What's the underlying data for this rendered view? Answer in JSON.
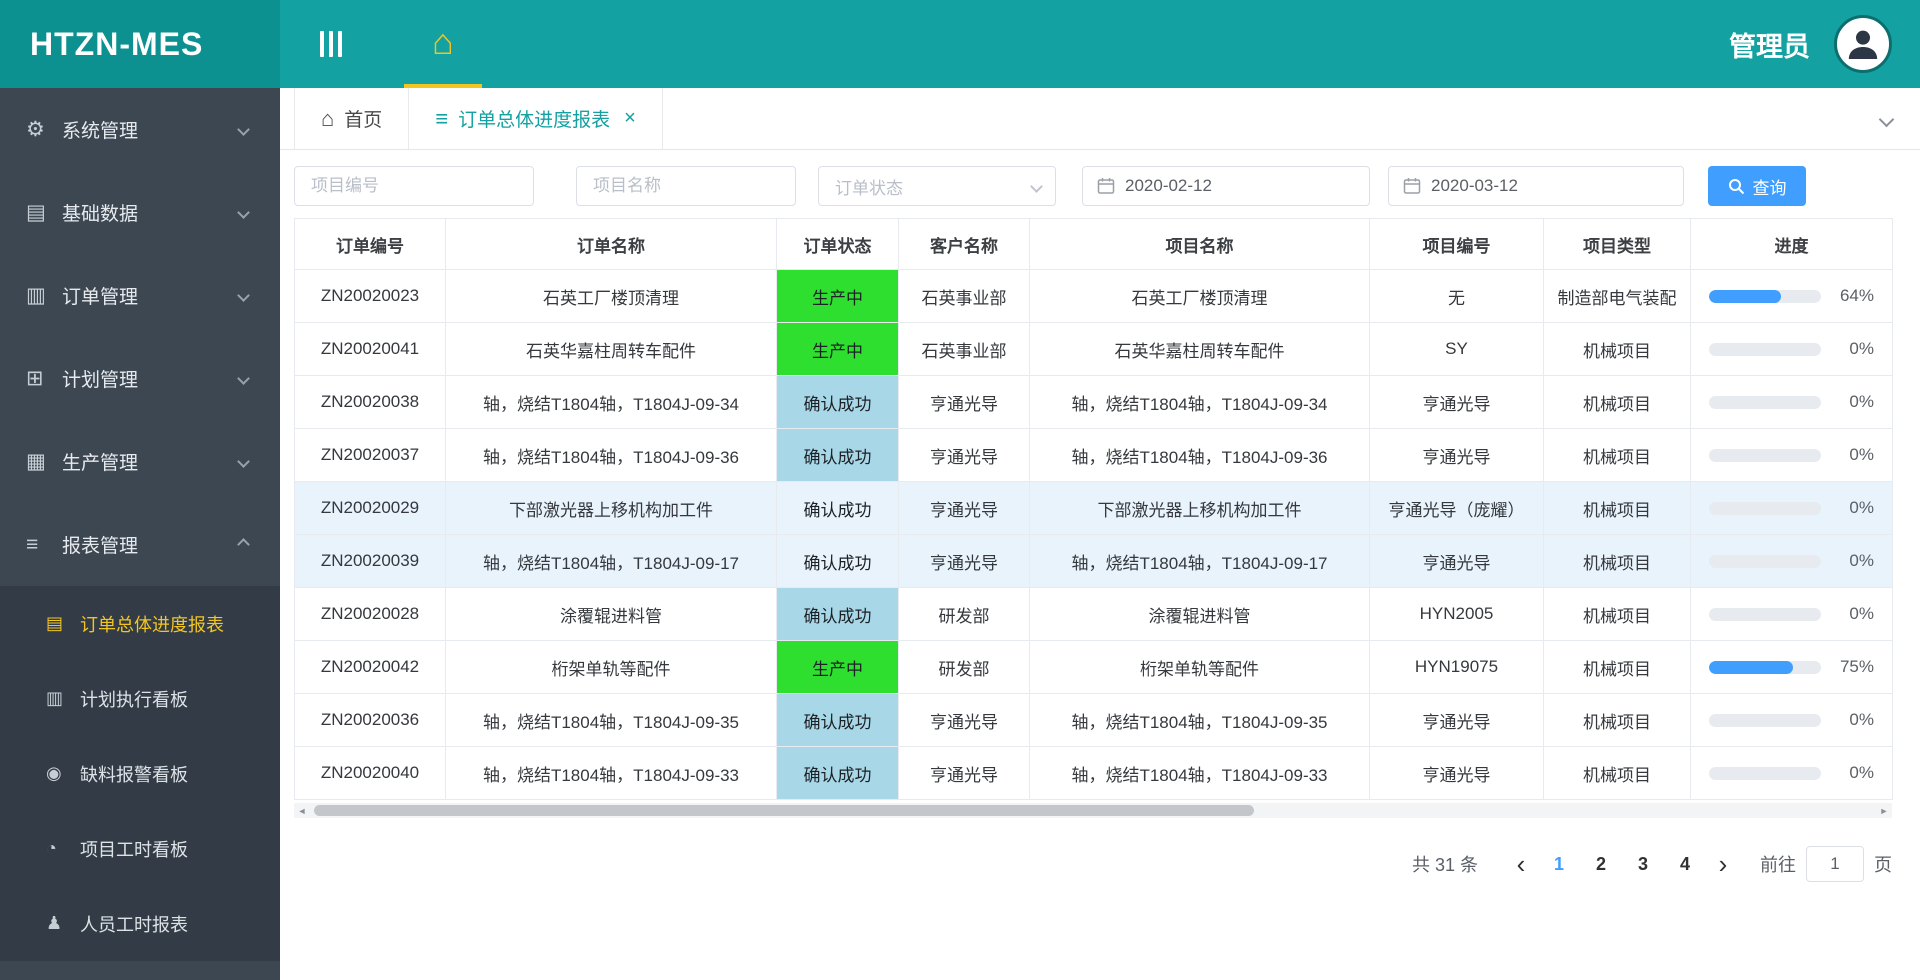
{
  "app": {
    "logo": "HTZN-MES",
    "user": "管理员"
  },
  "colors": {
    "header_teal": "#13a1a1",
    "logo_teal": "#0c9090",
    "sidebar_dark": "#3d4751",
    "active_gold": "#f2c521",
    "primary_blue": "#409eff",
    "status_green": "#2fdf2f",
    "status_light_blue": "#a8d8e8",
    "highlight_row": "#e8f3fc"
  },
  "sidebar": {
    "items": [
      {
        "label": "系统管理",
        "glyph": "⚙"
      },
      {
        "label": "基础数据",
        "glyph": "▤"
      },
      {
        "label": "订单管理",
        "glyph": "▥"
      },
      {
        "label": "计划管理",
        "glyph": "⊞"
      },
      {
        "label": "生产管理",
        "glyph": "▦"
      },
      {
        "label": "报表管理",
        "glyph": "≡"
      }
    ],
    "report_subitems": [
      {
        "label": "订单总体进度报表",
        "glyph": "▤",
        "active": true
      },
      {
        "label": "计划执行看板",
        "glyph": "▥"
      },
      {
        "label": "缺料报警看板",
        "glyph": "◉"
      },
      {
        "label": "项目工时看板",
        "glyph": "◔"
      },
      {
        "label": "人员工时报表",
        "glyph": "♟"
      }
    ]
  },
  "tabs": {
    "home": {
      "label": "首页",
      "glyph": "⌂"
    },
    "report": {
      "label": "订单总体进度报表",
      "glyph": "≡",
      "close": "×"
    }
  },
  "filters": {
    "project_no_placeholder": "项目编号",
    "project_name_placeholder": "项目名称",
    "order_status_placeholder": "订单状态",
    "date_from": "2020-02-12",
    "date_to": "2020-03-12",
    "search_label": "查询"
  },
  "table": {
    "headers": [
      "订单编号",
      "订单名称",
      "订单状态",
      "客户名称",
      "项目名称",
      "项目编号",
      "项目类型",
      "进度"
    ],
    "rows": [
      {
        "order_no": "ZN20020023",
        "order_name": "石英工厂楼顶清理",
        "status": "生产中",
        "status_type": "green",
        "customer": "石英事业部",
        "project_name": "石英工厂楼顶清理",
        "project_no": "无",
        "project_type": "制造部电气装配",
        "progress": 64,
        "highlight": false
      },
      {
        "order_no": "ZN20020041",
        "order_name": "石英华嘉柱周转车配件",
        "status": "生产中",
        "status_type": "green",
        "customer": "石英事业部",
        "project_name": "石英华嘉柱周转车配件",
        "project_no": "SY",
        "project_type": "机械项目",
        "progress": 0,
        "highlight": false
      },
      {
        "order_no": "ZN20020038",
        "order_name": "轴，烧结T1804轴，T1804J-09-34",
        "status": "确认成功",
        "status_type": "blue",
        "customer": "亨通光导",
        "project_name": "轴，烧结T1804轴，T1804J-09-34",
        "project_no": "亨通光导",
        "project_type": "机械项目",
        "progress": 0,
        "highlight": false
      },
      {
        "order_no": "ZN20020037",
        "order_name": "轴，烧结T1804轴，T1804J-09-36",
        "status": "确认成功",
        "status_type": "blue",
        "customer": "亨通光导",
        "project_name": "轴，烧结T1804轴，T1804J-09-36",
        "project_no": "亨通光导",
        "project_type": "机械项目",
        "progress": 0,
        "highlight": false
      },
      {
        "order_no": "ZN20020029",
        "order_name": "下部激光器上移机构加工件",
        "status": "确认成功",
        "status_type": "blue",
        "customer": "亨通光导",
        "project_name": "下部激光器上移机构加工件",
        "project_no": "亨通光导（庞耀）",
        "project_type": "机械项目",
        "progress": 0,
        "highlight": true
      },
      {
        "order_no": "ZN20020039",
        "order_name": "轴，烧结T1804轴，T1804J-09-17",
        "status": "确认成功",
        "status_type": "blue",
        "customer": "亨通光导",
        "project_name": "轴，烧结T1804轴，T1804J-09-17",
        "project_no": "亨通光导",
        "project_type": "机械项目",
        "progress": 0,
        "highlight": true
      },
      {
        "order_no": "ZN20020028",
        "order_name": "涂覆辊进料管",
        "status": "确认成功",
        "status_type": "blue",
        "customer": "研发部",
        "project_name": "涂覆辊进料管",
        "project_no": "HYN2005",
        "project_type": "机械项目",
        "progress": 0,
        "highlight": false
      },
      {
        "order_no": "ZN20020042",
        "order_name": "桁架单轨等配件",
        "status": "生产中",
        "status_type": "green",
        "customer": "研发部",
        "project_name": "桁架单轨等配件",
        "project_no": "HYN19075",
        "project_type": "机械项目",
        "progress": 75,
        "highlight": false
      },
      {
        "order_no": "ZN20020036",
        "order_name": "轴，烧结T1804轴，T1804J-09-35",
        "status": "确认成功",
        "status_type": "blue",
        "customer": "亨通光导",
        "project_name": "轴，烧结T1804轴，T1804J-09-35",
        "project_no": "亨通光导",
        "project_type": "机械项目",
        "progress": 0,
        "highlight": false
      },
      {
        "order_no": "ZN20020040",
        "order_name": "轴，烧结T1804轴，T1804J-09-33",
        "status": "确认成功",
        "status_type": "blue",
        "customer": "亨通光导",
        "project_name": "轴，烧结T1804轴，T1804J-09-33",
        "project_no": "亨通光导",
        "project_type": "机械项目",
        "progress": 0,
        "highlight": false
      }
    ]
  },
  "pagination": {
    "total_text": "共 31 条",
    "prev": "‹",
    "next": "›",
    "pages": [
      "1",
      "2",
      "3",
      "4"
    ],
    "active_page": "1",
    "goto_label": "前往",
    "goto_value": "1",
    "page_label": "页"
  }
}
